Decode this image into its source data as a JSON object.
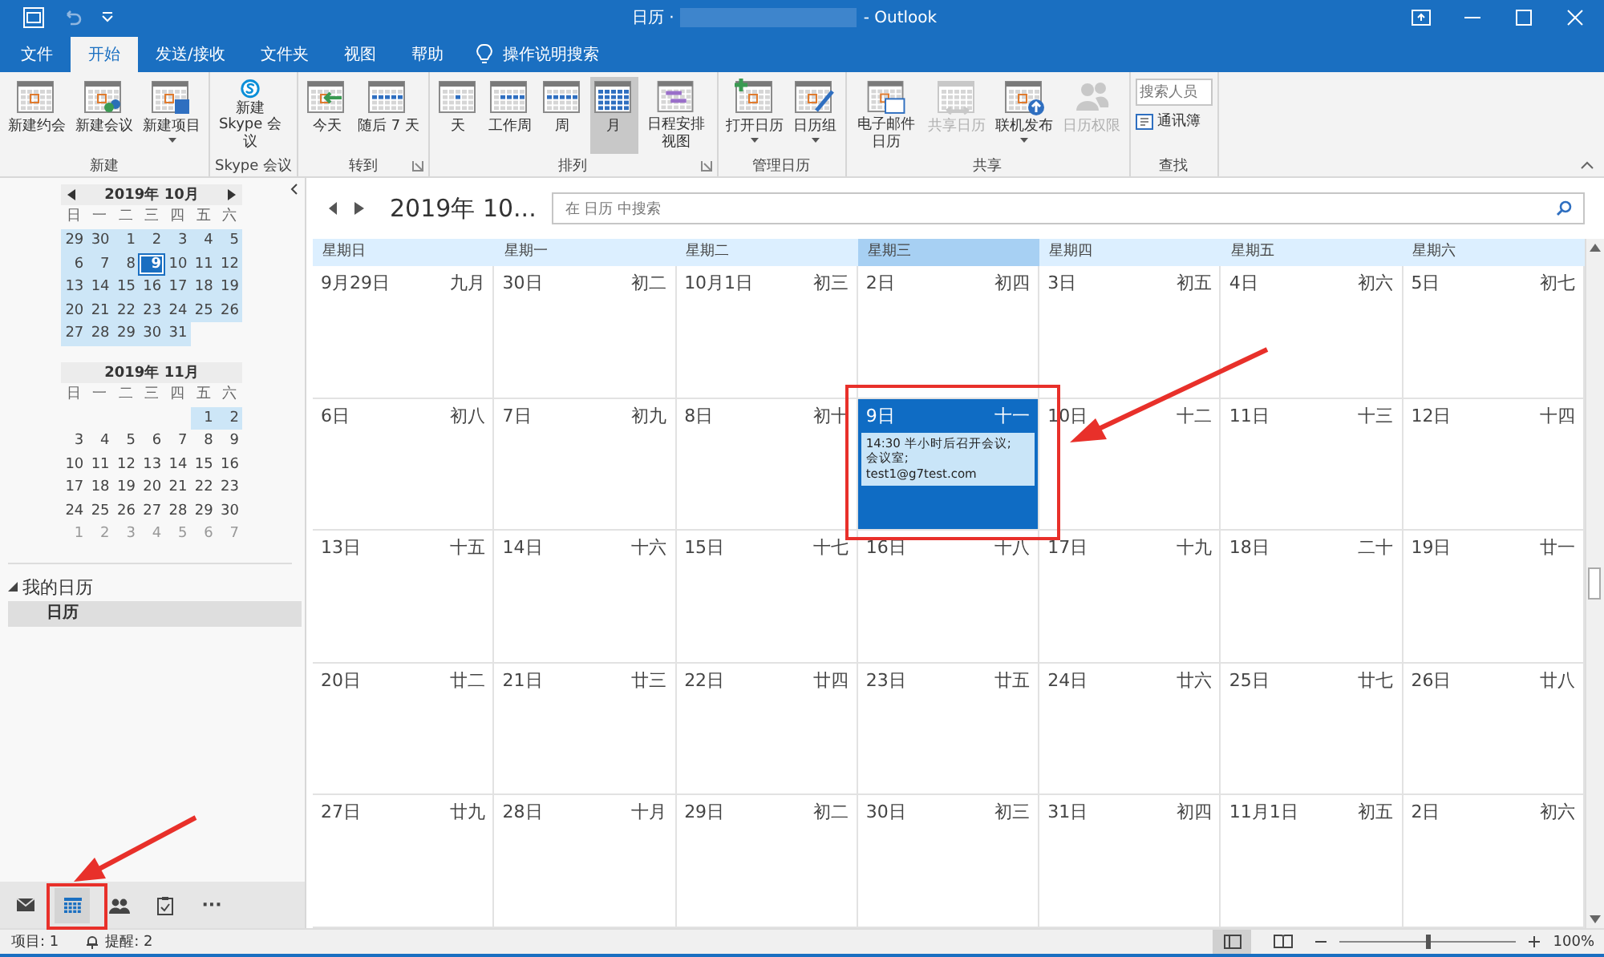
{
  "window": {
    "title_start": "日历 ·",
    "title_end": "- Outlook"
  },
  "tabs": [
    {
      "label": "文件",
      "selected": false
    },
    {
      "label": "开始",
      "selected": true
    },
    {
      "label": "发送/接收",
      "selected": false
    },
    {
      "label": "文件夹",
      "selected": false
    },
    {
      "label": "视图",
      "selected": false
    },
    {
      "label": "帮助",
      "selected": false
    }
  ],
  "tell_me": {
    "placeholder": "操作说明搜索"
  },
  "ribbon": [
    {
      "label": "新建",
      "launcher": false,
      "buttons": [
        {
          "label": "新建约会",
          "selected": false,
          "disabled": false,
          "dropdown": false
        },
        {
          "label": "新建会议",
          "selected": false,
          "disabled": false,
          "dropdown": false
        },
        {
          "label": "新建项目",
          "selected": false,
          "disabled": false,
          "dropdown": true
        }
      ]
    },
    {
      "label": "Skype 会议",
      "launcher": false,
      "buttons": [
        {
          "label": "新建\nSkype 会议",
          "selected": false,
          "disabled": false,
          "dropdown": false
        }
      ]
    },
    {
      "label": "转到",
      "launcher": true,
      "buttons": [
        {
          "label": "今天",
          "selected": false,
          "disabled": false,
          "dropdown": false
        },
        {
          "label": "随后 7 天",
          "selected": false,
          "disabled": false,
          "dropdown": false
        }
      ]
    },
    {
      "label": "排列",
      "launcher": true,
      "buttons": [
        {
          "label": "天",
          "selected": false,
          "disabled": false,
          "dropdown": false
        },
        {
          "label": "工作周",
          "selected": false,
          "disabled": false,
          "dropdown": false
        },
        {
          "label": "周",
          "selected": false,
          "disabled": false,
          "dropdown": false
        },
        {
          "label": "月",
          "selected": true,
          "disabled": false,
          "dropdown": false
        },
        {
          "label": "日程安排视图",
          "selected": false,
          "disabled": false,
          "dropdown": false
        }
      ]
    },
    {
      "label": "管理日历",
      "launcher": false,
      "buttons": [
        {
          "label": "打开日历",
          "selected": false,
          "disabled": false,
          "dropdown": true
        },
        {
          "label": "日历组",
          "selected": false,
          "disabled": false,
          "dropdown": true
        }
      ]
    },
    {
      "label": "共享",
      "launcher": false,
      "buttons": [
        {
          "label": "电子邮件日历",
          "selected": false,
          "disabled": false,
          "dropdown": false
        },
        {
          "label": "共享日历",
          "selected": false,
          "disabled": true,
          "dropdown": false
        },
        {
          "label": "联机发布",
          "selected": false,
          "disabled": false,
          "dropdown": true
        },
        {
          "label": "日历权限",
          "selected": false,
          "disabled": true,
          "dropdown": false
        }
      ]
    }
  ],
  "find": {
    "label": "查找",
    "search": {
      "placeholder": "搜索人员"
    },
    "address_book": "通讯簿"
  },
  "mini_calendars": [
    {
      "title": "2019年 10月",
      "weekdays": [
        "日",
        "一",
        "二",
        "三",
        "四",
        "五",
        "六"
      ],
      "weeks": [
        [
          {
            "day": "29",
            "in_view": true,
            "selected": false,
            "dimmed": false
          },
          {
            "day": "30",
            "in_view": true,
            "selected": false,
            "dimmed": false
          },
          {
            "day": "1",
            "in_view": true,
            "selected": false,
            "dimmed": false
          },
          {
            "day": "2",
            "in_view": true,
            "selected": false,
            "dimmed": false
          },
          {
            "day": "3",
            "in_view": true,
            "selected": false,
            "dimmed": false
          },
          {
            "day": "4",
            "in_view": true,
            "selected": false,
            "dimmed": false
          },
          {
            "day": "5",
            "in_view": true,
            "selected": false,
            "dimmed": false
          }
        ],
        [
          {
            "day": "6",
            "in_view": true,
            "selected": false,
            "dimmed": false
          },
          {
            "day": "7",
            "in_view": true,
            "selected": false,
            "dimmed": false
          },
          {
            "day": "8",
            "in_view": true,
            "selected": false,
            "dimmed": false
          },
          {
            "day": "9",
            "in_view": true,
            "selected": true,
            "dimmed": false
          },
          {
            "day": "10",
            "in_view": true,
            "selected": false,
            "dimmed": false
          },
          {
            "day": "11",
            "in_view": true,
            "selected": false,
            "dimmed": false
          },
          {
            "day": "12",
            "in_view": true,
            "selected": false,
            "dimmed": false
          }
        ],
        [
          {
            "day": "13",
            "in_view": true,
            "selected": false,
            "dimmed": false
          },
          {
            "day": "14",
            "in_view": true,
            "selected": false,
            "dimmed": false
          },
          {
            "day": "15",
            "in_view": true,
            "selected": false,
            "dimmed": false
          },
          {
            "day": "16",
            "in_view": true,
            "selected": false,
            "dimmed": false
          },
          {
            "day": "17",
            "in_view": true,
            "selected": false,
            "dimmed": false
          },
          {
            "day": "18",
            "in_view": true,
            "selected": false,
            "dimmed": false
          },
          {
            "day": "19",
            "in_view": true,
            "selected": false,
            "dimmed": false
          }
        ],
        [
          {
            "day": "20",
            "in_view": true,
            "selected": false,
            "dimmed": false
          },
          {
            "day": "21",
            "in_view": true,
            "selected": false,
            "dimmed": false
          },
          {
            "day": "22",
            "in_view": true,
            "selected": false,
            "dimmed": false
          },
          {
            "day": "23",
            "in_view": true,
            "selected": false,
            "dimmed": false
          },
          {
            "day": "24",
            "in_view": true,
            "selected": false,
            "dimmed": false
          },
          {
            "day": "25",
            "in_view": true,
            "selected": false,
            "dimmed": false
          },
          {
            "day": "26",
            "in_view": true,
            "selected": false,
            "dimmed": false
          }
        ],
        [
          {
            "day": "27",
            "in_view": true,
            "selected": false,
            "dimmed": false
          },
          {
            "day": "28",
            "in_view": true,
            "selected": false,
            "dimmed": false
          },
          {
            "day": "29",
            "in_view": true,
            "selected": false,
            "dimmed": false
          },
          {
            "day": "30",
            "in_view": true,
            "selected": false,
            "dimmed": false
          },
          {
            "day": "31",
            "in_view": true,
            "selected": false,
            "dimmed": false
          }
        ]
      ]
    },
    {
      "title": "2019年 11月",
      "weekdays": [
        "日",
        "一",
        "二",
        "三",
        "四",
        "五",
        "六"
      ],
      "weeks": [
        [
          {
            "day": "1",
            "in_view": true,
            "selected": false,
            "dimmed": false
          },
          {
            "day": "2",
            "in_view": true,
            "selected": false,
            "dimmed": false
          }
        ],
        [
          {
            "day": "3",
            "in_view": false,
            "selected": false,
            "dimmed": false
          },
          {
            "day": "4",
            "in_view": false,
            "selected": false,
            "dimmed": false
          },
          {
            "day": "5",
            "in_view": false,
            "selected": false,
            "dimmed": false
          },
          {
            "day": "6",
            "in_view": false,
            "selected": false,
            "dimmed": false
          },
          {
            "day": "7",
            "in_view": false,
            "selected": false,
            "dimmed": false
          },
          {
            "day": "8",
            "in_view": false,
            "selected": false,
            "dimmed": false
          },
          {
            "day": "9",
            "in_view": false,
            "selected": false,
            "dimmed": false
          }
        ],
        [
          {
            "day": "10",
            "in_view": false,
            "selected": false,
            "dimmed": false
          },
          {
            "day": "11",
            "in_view": false,
            "selected": false,
            "dimmed": false
          },
          {
            "day": "12",
            "in_view": false,
            "selected": false,
            "dimmed": false
          },
          {
            "day": "13",
            "in_view": false,
            "selected": false,
            "dimmed": false
          },
          {
            "day": "14",
            "in_view": false,
            "selected": false,
            "dimmed": false
          },
          {
            "day": "15",
            "in_view": false,
            "selected": false,
            "dimmed": false
          },
          {
            "day": "16",
            "in_view": false,
            "selected": false,
            "dimmed": false
          }
        ],
        [
          {
            "day": "17",
            "in_view": false,
            "selected": false,
            "dimmed": false
          },
          {
            "day": "18",
            "in_view": false,
            "selected": false,
            "dimmed": false
          },
          {
            "day": "19",
            "in_view": false,
            "selected": false,
            "dimmed": false
          },
          {
            "day": "20",
            "in_view": false,
            "selected": false,
            "dimmed": false
          },
          {
            "day": "21",
            "in_view": false,
            "selected": false,
            "dimmed": false
          },
          {
            "day": "22",
            "in_view": false,
            "selected": false,
            "dimmed": false
          },
          {
            "day": "23",
            "in_view": false,
            "selected": false,
            "dimmed": false
          }
        ],
        [
          {
            "day": "24",
            "in_view": false,
            "selected": false,
            "dimmed": false
          },
          {
            "day": "25",
            "in_view": false,
            "selected": false,
            "dimmed": false
          },
          {
            "day": "26",
            "in_view": false,
            "selected": false,
            "dimmed": false
          },
          {
            "day": "27",
            "in_view": false,
            "selected": false,
            "dimmed": false
          },
          {
            "day": "28",
            "in_view": false,
            "selected": false,
            "dimmed": false
          },
          {
            "day": "29",
            "in_view": false,
            "selected": false,
            "dimmed": false
          },
          {
            "day": "30",
            "in_view": false,
            "selected": false,
            "dimmed": false
          }
        ],
        [
          {
            "day": "1",
            "in_view": false,
            "selected": false,
            "dimmed": true
          },
          {
            "day": "2",
            "in_view": false,
            "selected": false,
            "dimmed": true
          },
          {
            "day": "3",
            "in_view": false,
            "selected": false,
            "dimmed": true
          },
          {
            "day": "4",
            "in_view": false,
            "selected": false,
            "dimmed": true
          },
          {
            "day": "5",
            "in_view": false,
            "selected": false,
            "dimmed": true
          },
          {
            "day": "6",
            "in_view": false,
            "selected": false,
            "dimmed": true
          },
          {
            "day": "7",
            "in_view": false,
            "selected": false,
            "dimmed": true
          }
        ]
      ]
    }
  ],
  "folders": [
    {
      "label": "我的日历",
      "expanded": true,
      "selected": false,
      "children": [
        {
          "label": "日历",
          "selected": true
        }
      ]
    }
  ],
  "nav": [
    {
      "selected": false
    },
    {
      "selected": true
    },
    {
      "selected": false
    },
    {
      "selected": false
    },
    {
      "label": "···",
      "selected": false
    }
  ],
  "calendar": {
    "title": "2019年 10...",
    "search": {
      "placeholder": "在 日历 中搜索"
    },
    "weekdays": [
      {
        "label": "星期日",
        "selected": false
      },
      {
        "label": "星期一",
        "selected": false
      },
      {
        "label": "星期二",
        "selected": false
      },
      {
        "label": "星期三",
        "selected": true
      },
      {
        "label": "星期四",
        "selected": false
      },
      {
        "label": "星期五",
        "selected": false
      },
      {
        "label": "星期六",
        "selected": false
      }
    ],
    "weeks": [
      [
        {
          "date": "9月29日",
          "lunar": "九月",
          "selected": false
        },
        {
          "date": "30日",
          "lunar": "初二",
          "selected": false
        },
        {
          "date": "10月1日",
          "lunar": "初三",
          "selected": false
        },
        {
          "date": "2日",
          "lunar": "初四",
          "selected": false
        },
        {
          "date": "3日",
          "lunar": "初五",
          "selected": false
        },
        {
          "date": "4日",
          "lunar": "初六",
          "selected": false
        },
        {
          "date": "5日",
          "lunar": "初七",
          "selected": false
        }
      ],
      [
        {
          "date": "6日",
          "lunar": "初八",
          "selected": false
        },
        {
          "date": "7日",
          "lunar": "初九",
          "selected": false
        },
        {
          "date": "8日",
          "lunar": "初十",
          "selected": false
        },
        {
          "date": "9日",
          "lunar": "十一",
          "selected": true,
          "appointment": "14:30 半小时后召开会议;\n会议室;\ntest1@g7test.com"
        },
        {
          "date": "10日",
          "lunar": "十二",
          "selected": false
        },
        {
          "date": "11日",
          "lunar": "十三",
          "selected": false
        },
        {
          "date": "12日",
          "lunar": "十四",
          "selected": false
        }
      ],
      [
        {
          "date": "13日",
          "lunar": "十五",
          "selected": false
        },
        {
          "date": "14日",
          "lunar": "十六",
          "selected": false
        },
        {
          "date": "15日",
          "lunar": "十七",
          "selected": false
        },
        {
          "date": "16日",
          "lunar": "十八",
          "selected": false
        },
        {
          "date": "17日",
          "lunar": "十九",
          "selected": false
        },
        {
          "date": "18日",
          "lunar": "二十",
          "selected": false
        },
        {
          "date": "19日",
          "lunar": "廿一",
          "selected": false
        }
      ],
      [
        {
          "date": "20日",
          "lunar": "廿二",
          "selected": false
        },
        {
          "date": "21日",
          "lunar": "廿三",
          "selected": false
        },
        {
          "date": "22日",
          "lunar": "廿四",
          "selected": false
        },
        {
          "date": "23日",
          "lunar": "廿五",
          "selected": false
        },
        {
          "date": "24日",
          "lunar": "廿六",
          "selected": false
        },
        {
          "date": "25日",
          "lunar": "廿七",
          "selected": false
        },
        {
          "date": "26日",
          "lunar": "廿八",
          "selected": false
        }
      ],
      [
        {
          "date": "27日",
          "lunar": "廿九",
          "selected": false
        },
        {
          "date": "28日",
          "lunar": "十月",
          "selected": false
        },
        {
          "date": "29日",
          "lunar": "初二",
          "selected": false
        },
        {
          "date": "30日",
          "lunar": "初三",
          "selected": false
        },
        {
          "date": "31日",
          "lunar": "初四",
          "selected": false
        },
        {
          "date": "11月1日",
          "lunar": "初五",
          "selected": false
        },
        {
          "date": "2日",
          "lunar": "初六",
          "selected": false
        }
      ]
    ]
  },
  "status_bar": {
    "items": "项目: 1",
    "reminders": "提醒: 2",
    "zoom": {
      "level": 0.5,
      "reading": "100%"
    }
  }
}
